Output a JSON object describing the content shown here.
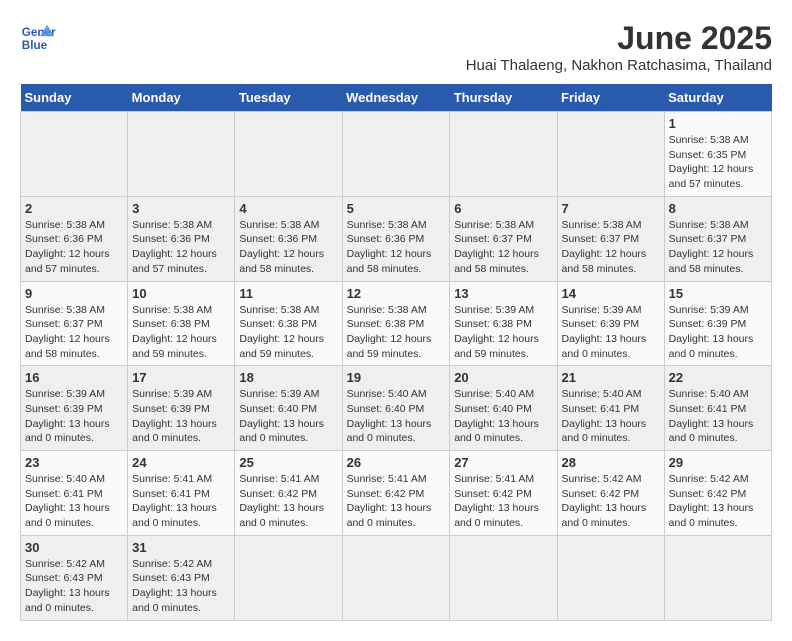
{
  "header": {
    "logo_line1": "General",
    "logo_line2": "Blue",
    "title": "June 2025",
    "subtitle": "Huai Thalaeng, Nakhon Ratchasima, Thailand"
  },
  "calendar": {
    "days_of_week": [
      "Sunday",
      "Monday",
      "Tuesday",
      "Wednesday",
      "Thursday",
      "Friday",
      "Saturday"
    ],
    "weeks": [
      [
        null,
        null,
        null,
        null,
        null,
        null,
        null
      ]
    ],
    "cells": [
      {
        "day": null
      },
      {
        "day": null
      },
      {
        "day": null
      },
      {
        "day": null
      },
      {
        "day": null
      },
      {
        "day": null
      },
      {
        "day": null
      }
    ],
    "rows": [
      [
        {
          "date": null,
          "info": ""
        },
        {
          "date": null,
          "info": ""
        },
        {
          "date": null,
          "info": ""
        },
        {
          "date": null,
          "info": ""
        },
        {
          "date": null,
          "info": ""
        },
        {
          "date": null,
          "info": ""
        },
        {
          "date": null,
          "info": ""
        }
      ]
    ]
  }
}
